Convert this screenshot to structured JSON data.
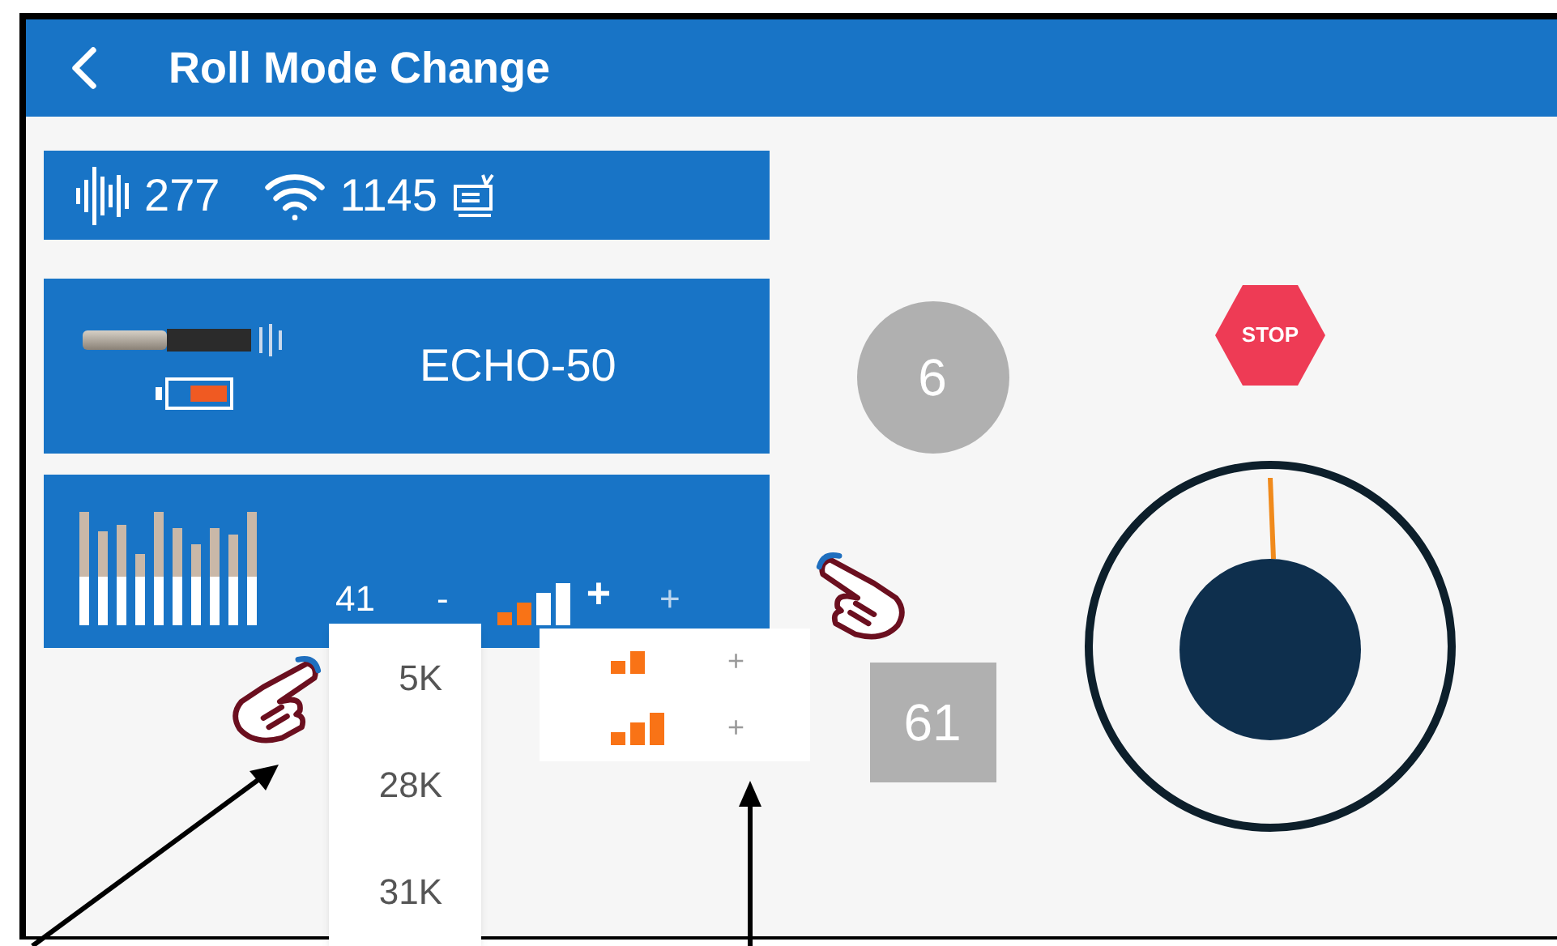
{
  "header": {
    "title": "Roll Mode Change"
  },
  "status_panel": {
    "sound_count": "277",
    "wifi_count": "1145"
  },
  "device_panel": {
    "name": "ECHO-50",
    "battery": {
      "level": 0.7
    }
  },
  "gain_panel": {
    "rate": "41",
    "minus": "-",
    "plus": "+",
    "plus_2": "+"
  },
  "rate_menu": {
    "items": [
      {
        "label": "5K"
      },
      {
        "label": "28K"
      },
      {
        "label": "31K"
      }
    ]
  },
  "level_menu": {
    "items": [
      {
        "kind": "low",
        "plus": "+"
      },
      {
        "kind": "medium",
        "plus": "+"
      }
    ]
  },
  "counters": {
    "circle": "6",
    "square": "61"
  },
  "stop_sign": {
    "label": "STOP"
  }
}
